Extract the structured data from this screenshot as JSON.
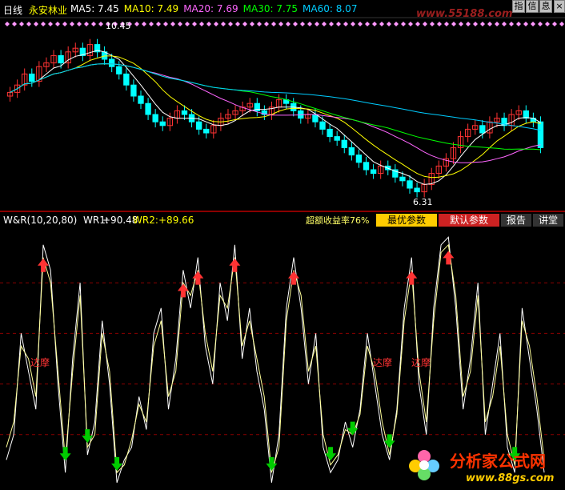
{
  "header": {
    "period": "日线",
    "stock_name": "永安林业",
    "ma": [
      {
        "label": "MA5:",
        "value": "7.45",
        "color": "#ffffff"
      },
      {
        "label": "MA10:",
        "value": "7.49",
        "color": "#ffff00"
      },
      {
        "label": "MA20:",
        "value": "7.69",
        "color": "#ff66ff"
      },
      {
        "label": "MA30:",
        "value": "7.75",
        "color": "#00ff00"
      },
      {
        "label": "MA60:",
        "value": "8.07",
        "color": "#00ccff"
      }
    ]
  },
  "toolbar": {
    "buttons": [
      "指",
      "信",
      "息"
    ]
  },
  "watermark_top": "www.55188.com",
  "price_panel": {
    "high_label": "10.45",
    "low_label": "6.31"
  },
  "indicator_header": {
    "name": "W&R(10,20,80)",
    "wr1_label": "WR1:",
    "wr1_value": "+90.48",
    "wr2_label": "WR2:",
    "wr2_value": "+89.66",
    "excess_return": "超额收益率76%"
  },
  "tabs": {
    "best_params": "最优参数",
    "default_params": "默认参数",
    "report": "报告",
    "lecture": "讲堂"
  },
  "annotations": {
    "damo": "达摩"
  },
  "bottom_logo": {
    "title": "分析家公式网",
    "url": "www.88gs.com"
  },
  "colors": {
    "up": "#ff3333",
    "down": "#00ffff",
    "wr": "#ffff99",
    "grid": "#8b0000",
    "buy_arrow": "#ff3333",
    "sell_arrow": "#00cc00"
  },
  "chart_data": [
    {
      "type": "candlestick",
      "title": "永安林业 日线",
      "ylim": [
        6.0,
        11.0
      ],
      "annotations": [
        {
          "text": "10.45",
          "kind": "high"
        },
        {
          "text": "6.31",
          "kind": "low"
        }
      ],
      "series_note": "price bars with MA5/MA10/MA20/MA30/MA60 overlays",
      "close": [
        9.1,
        9.3,
        9.6,
        9.4,
        9.8,
        9.9,
        10.1,
        9.9,
        10.2,
        10.3,
        10.1,
        10.4,
        10.2,
        10.0,
        9.8,
        9.6,
        9.3,
        9.0,
        8.8,
        8.5,
        8.3,
        8.2,
        8.4,
        8.6,
        8.5,
        8.3,
        8.1,
        8.0,
        8.2,
        8.4,
        8.5,
        8.6,
        8.7,
        8.8,
        8.6,
        8.5,
        8.7,
        8.9,
        8.8,
        8.6,
        8.4,
        8.5,
        8.3,
        8.1,
        7.9,
        7.8,
        7.6,
        7.4,
        7.2,
        7.0,
        6.9,
        7.1,
        7.0,
        6.8,
        6.7,
        6.5,
        6.4,
        6.6,
        6.9,
        7.1,
        7.3,
        7.6,
        7.9,
        8.1,
        8.2,
        8.0,
        8.3,
        8.4,
        8.2,
        8.5,
        8.6,
        8.4,
        8.3,
        7.6
      ]
    },
    {
      "type": "line",
      "title": "W&R(10,20,80)",
      "ylim": [
        0,
        100
      ],
      "reference_levels": [
        20,
        40,
        60,
        80
      ],
      "series": [
        {
          "name": "WR1",
          "values": [
            90,
            80,
            40,
            55,
            70,
            5,
            15,
            60,
            95,
            50,
            20,
            88,
            75,
            35,
            60,
            99,
            90,
            85,
            65,
            78,
            40,
            30,
            70,
            50,
            15,
            30,
            10,
            45,
            60,
            20,
            35,
            5,
            50,
            30,
            55,
            70,
            99,
            80,
            30,
            10,
            30,
            60,
            40,
            85,
            95,
            90,
            75,
            85,
            70,
            40,
            60,
            80,
            90,
            70,
            30,
            10,
            60,
            80,
            30,
            5,
            2,
            30,
            70,
            50,
            20,
            80,
            60,
            40,
            85,
            95,
            30,
            50,
            70,
            95
          ]
        },
        {
          "name": "WR2",
          "values": [
            85,
            75,
            45,
            50,
            65,
            10,
            20,
            55,
            90,
            55,
            25,
            85,
            80,
            40,
            55,
            95,
            92,
            82,
            68,
            75,
            45,
            35,
            65,
            55,
            20,
            25,
            15,
            40,
            55,
            25,
            30,
            10,
            45,
            35,
            50,
            65,
            95,
            85,
            35,
            15,
            25,
            55,
            45,
            80,
            92,
            88,
            78,
            80,
            72,
            45,
            55,
            75,
            88,
            72,
            35,
            15,
            55,
            75,
            35,
            8,
            5,
            25,
            65,
            55,
            25,
            75,
            65,
            45,
            80,
            92,
            35,
            45,
            65,
            90
          ]
        }
      ]
    }
  ]
}
